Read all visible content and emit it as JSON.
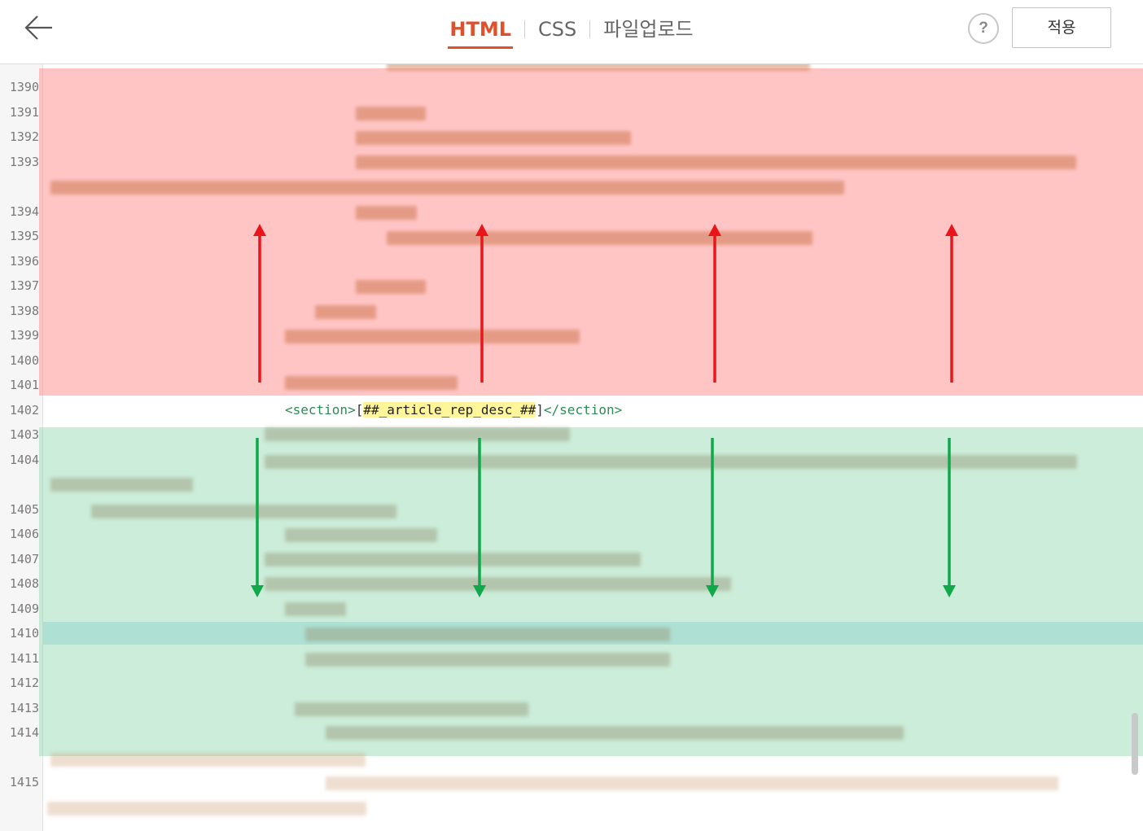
{
  "toolbar": {
    "back_icon": "arrow-left-icon",
    "tabs": [
      {
        "label": "HTML",
        "active": true
      },
      {
        "label": "CSS",
        "active": false
      },
      {
        "label": "파일업로드",
        "active": false
      }
    ],
    "help_label": "?",
    "apply_label": "적용",
    "accent_color": "#e0512b"
  },
  "editor": {
    "line_numbers": [
      "1390",
      "1391",
      "1392",
      "1393",
      "1394",
      "1395",
      "1396",
      "1397",
      "1398",
      "1399",
      "1400",
      "1401",
      "1402",
      "1403",
      "1404",
      "1405",
      "1406",
      "1407",
      "1408",
      "1409",
      "1410",
      "1411",
      "1412",
      "1413",
      "1414",
      "1415"
    ],
    "visible_code": {
      "open_tag": "<section>",
      "open_bracket": "[",
      "variable": "##_article_rep_desc_##",
      "close_bracket": "]",
      "close_tag": "</section>"
    },
    "region_above_color": "#ff9696",
    "region_below_color": "#8cd7aa",
    "arrow_up_color": "#e8161b",
    "arrow_down_color": "#10a84a"
  }
}
